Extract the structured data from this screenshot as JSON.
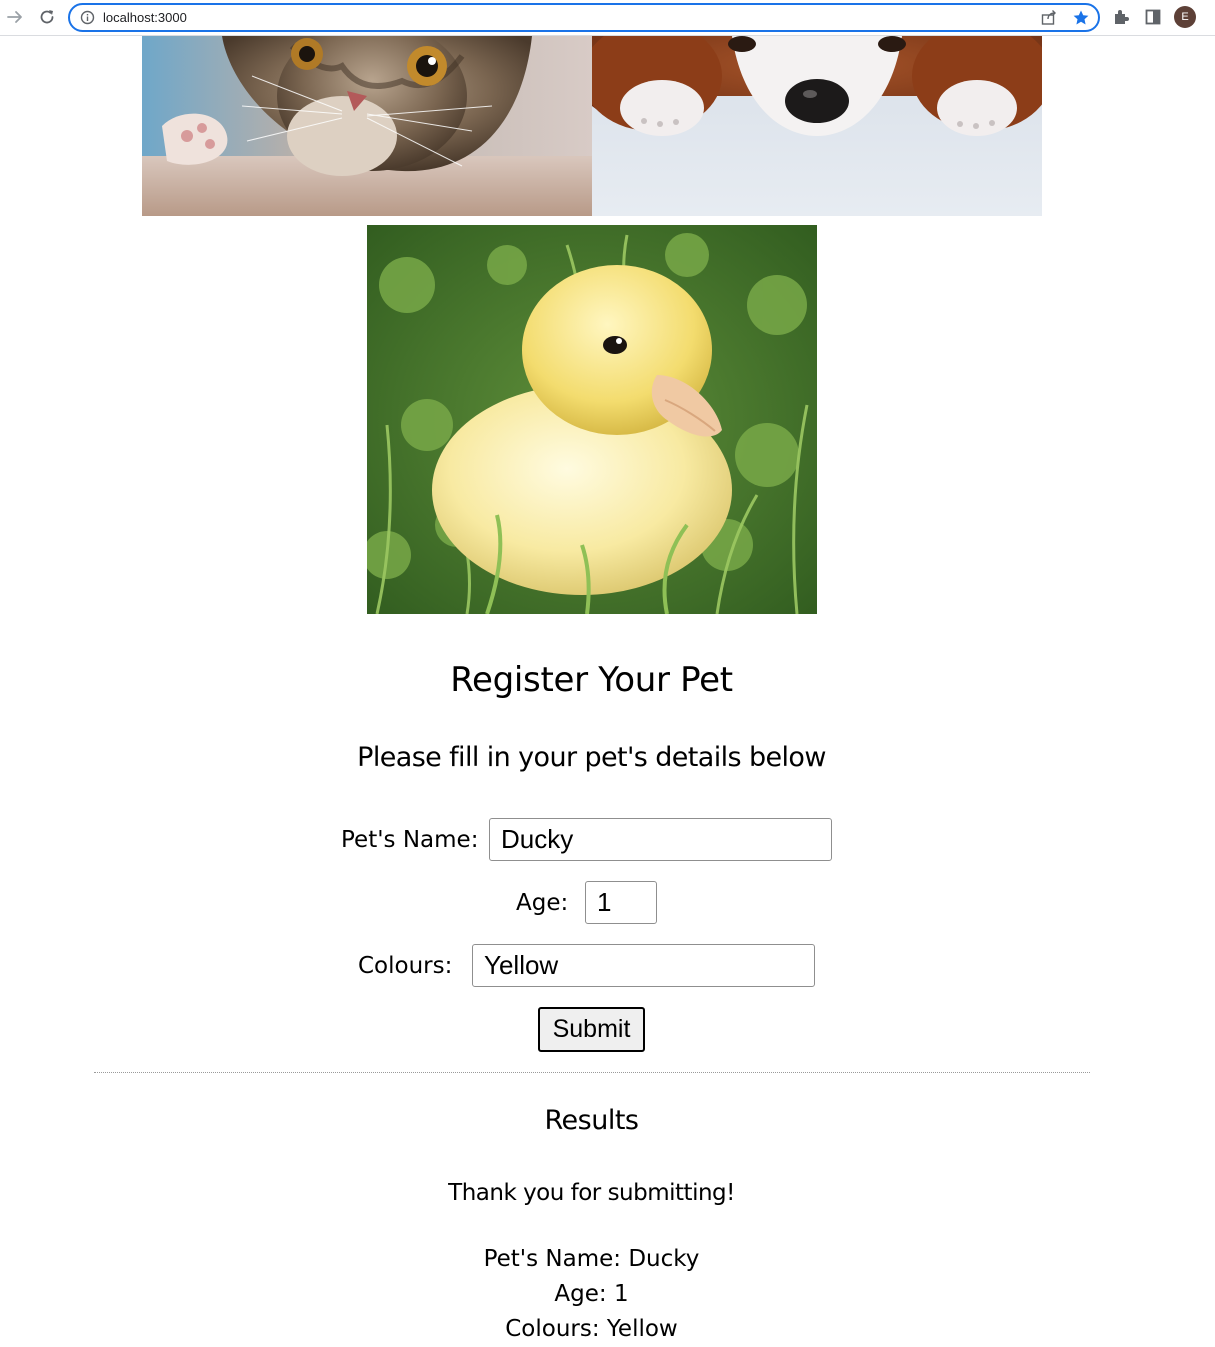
{
  "browser": {
    "url": "localhost:3000",
    "profile_initial": "E",
    "icons": [
      "forward-icon",
      "reload-icon",
      "info-icon",
      "share-icon",
      "bookmark-star-icon",
      "extensions-icon",
      "side-panel-icon"
    ],
    "accent_color": "#1a73e8"
  },
  "images": [
    {
      "name": "kitten-photo"
    },
    {
      "name": "puppy-photo"
    },
    {
      "name": "duckling-photo"
    }
  ],
  "page": {
    "title": "Register Your Pet",
    "subtitle": "Please fill in your pet's details below"
  },
  "form": {
    "name_label": "Pet's Name:",
    "name_value": "Ducky",
    "age_label": "Age:",
    "age_value": "1",
    "colours_label": "Colours:",
    "colours_value": "Yellow",
    "submit_label": "Submit"
  },
  "results": {
    "title": "Results",
    "thanks": "Thank you for submitting!",
    "name_line": "Pet's Name: Ducky",
    "age_line": "Age: 1",
    "colours_line": "Colours: Yellow"
  }
}
